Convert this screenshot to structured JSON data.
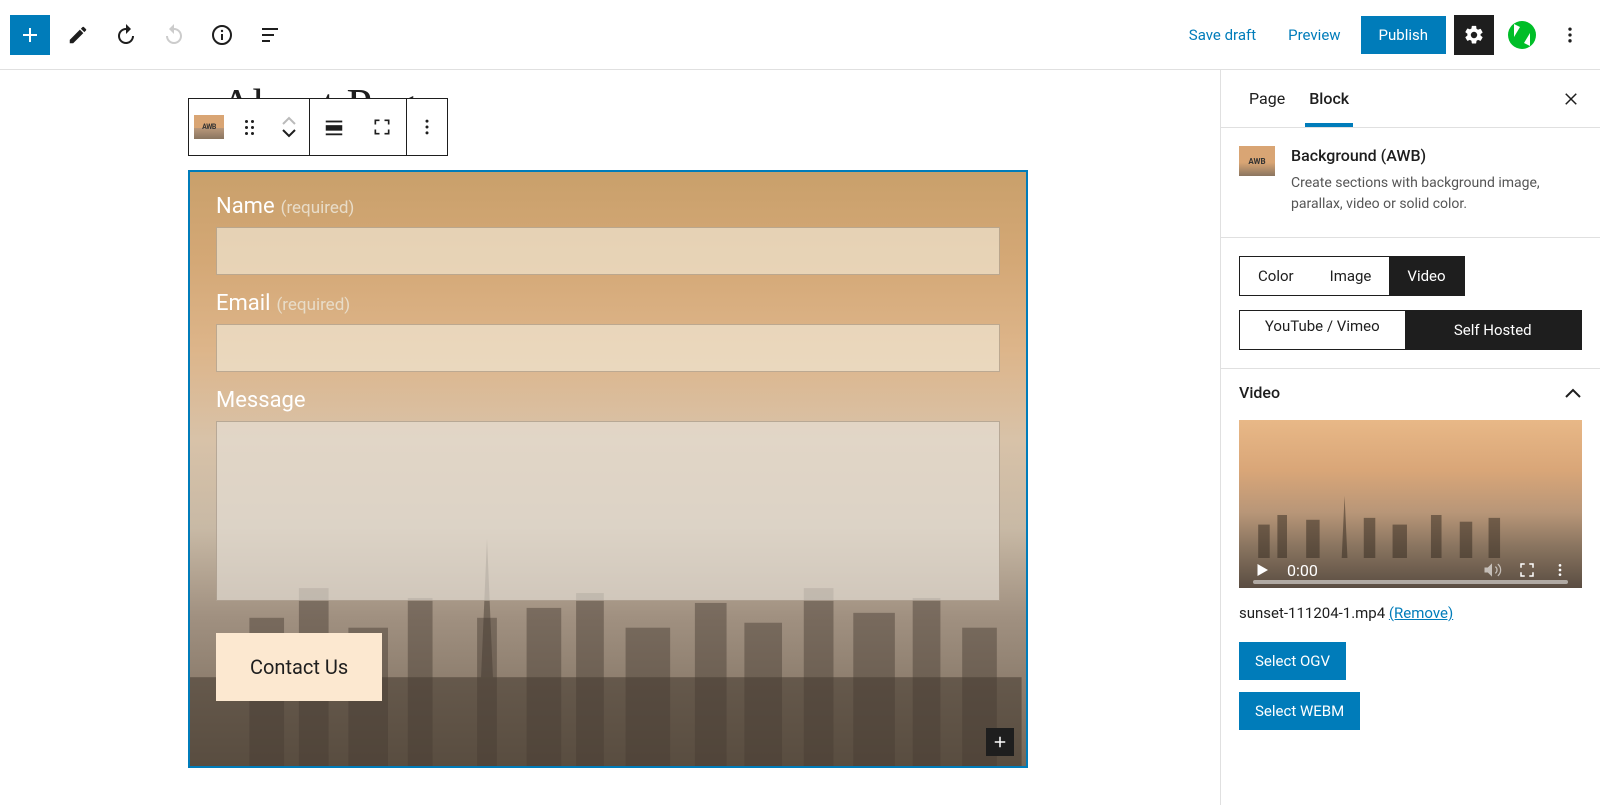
{
  "toolbar": {
    "save_draft": "Save draft",
    "preview": "Preview",
    "publish": "Publish"
  },
  "page_title": "About Page",
  "sidebar": {
    "tabs": {
      "page": "Page",
      "block": "Block"
    },
    "block_info": {
      "title": "Background (AWB)",
      "desc": "Create sections with background image, parallax, video or solid color."
    },
    "type_seg": {
      "color": "Color",
      "image": "Image",
      "video": "Video"
    },
    "source_seg": {
      "yt": "YouTube / Vimeo",
      "self": "Self Hosted"
    },
    "video_panel": "Video",
    "video_time": "0:00",
    "video_file": "sunset-111204-1.mp4",
    "remove": "(Remove)",
    "select_ogv": "Select OGV",
    "select_webm": "Select WEBM"
  },
  "block_toolbar": {
    "awb": "AWB"
  },
  "form": {
    "name_label": "Name",
    "email_label": "Email",
    "message_label": "Message",
    "required": "(required)",
    "submit": "Contact Us"
  }
}
